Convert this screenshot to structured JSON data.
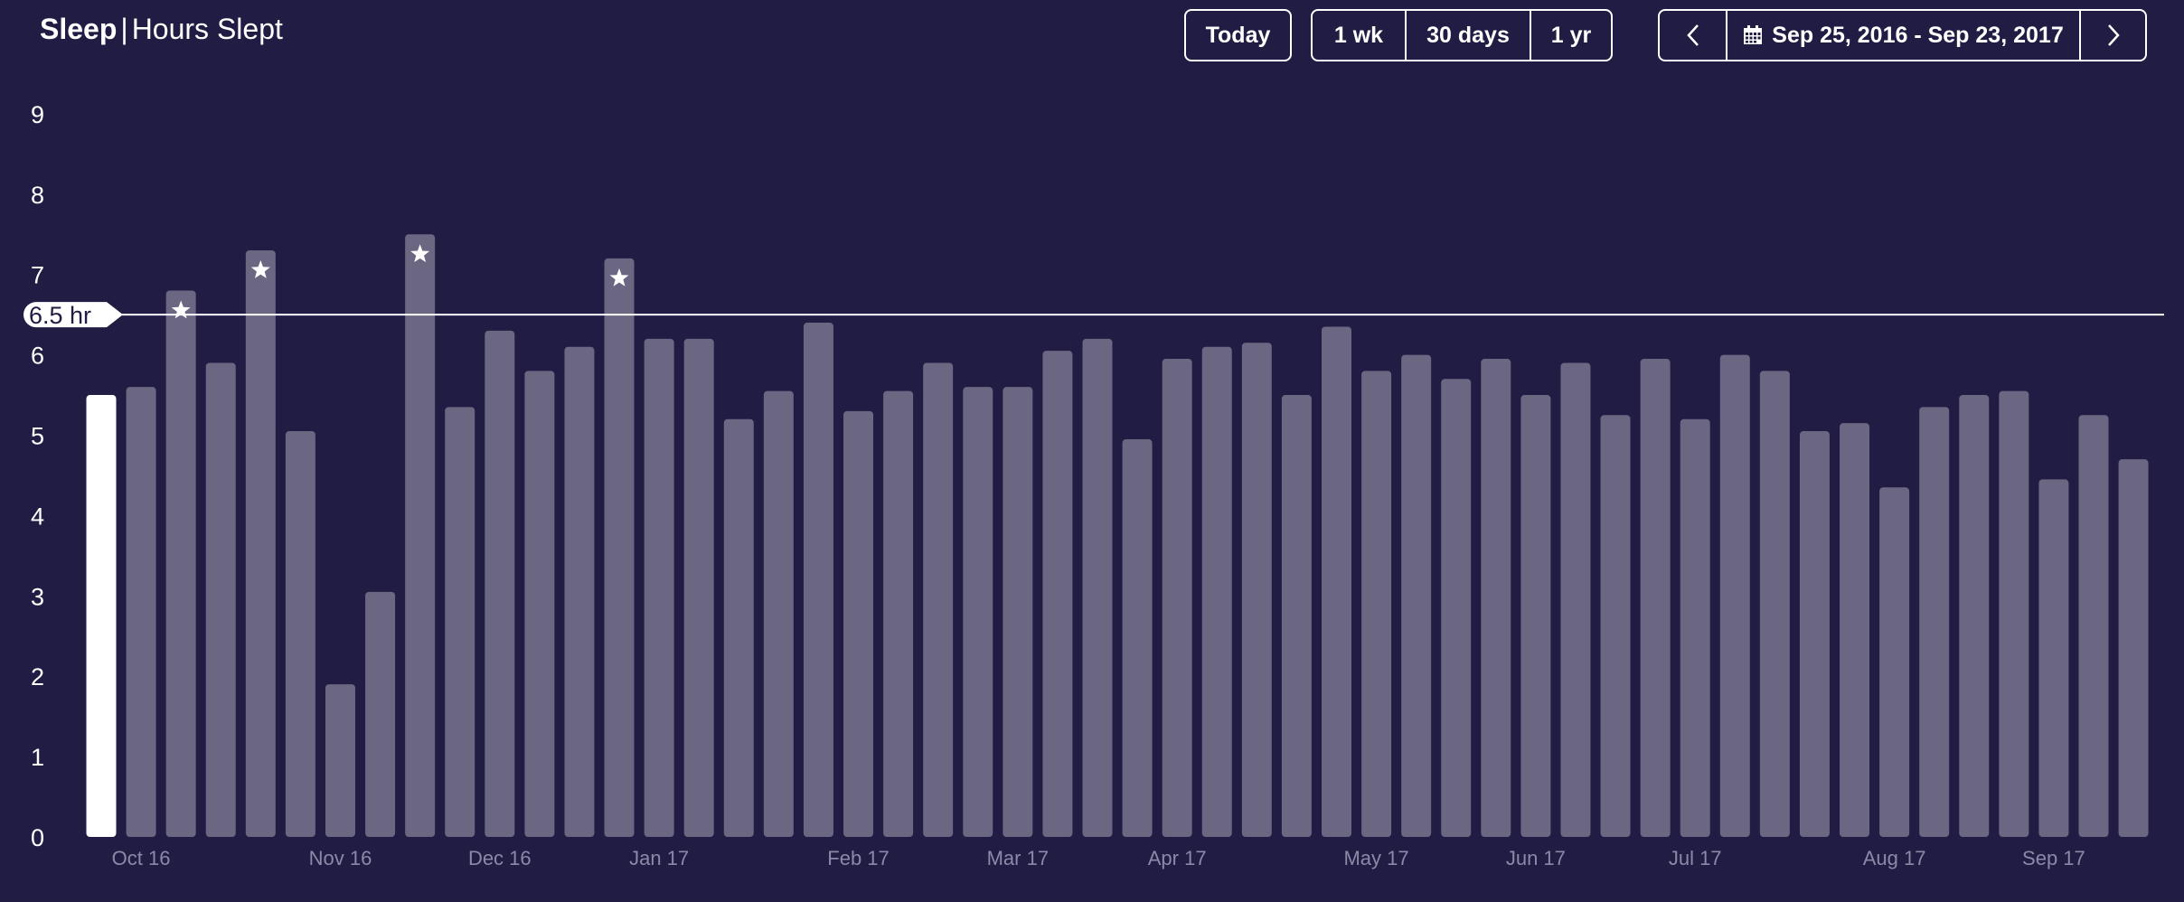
{
  "header": {
    "title": "Sleep",
    "separator": "|",
    "subtitle": "Hours Slept"
  },
  "controls": {
    "today": "Today",
    "ranges": [
      "1 wk",
      "30 days",
      "1 yr"
    ],
    "date_range": "Sep 25, 2016 - Sep 23, 2017"
  },
  "icons": {
    "prev": "chevron-left-icon",
    "next": "chevron-right-icon",
    "calendar": "calendar-icon",
    "goal_met": "star-icon"
  },
  "colors": {
    "background": "#201c44",
    "bar": "#6b6682",
    "current_bar": "#ffffff",
    "goal_line": "#ffffff",
    "text": "#ffffff",
    "month_label": "#8d88a8"
  },
  "chart_data": {
    "type": "bar",
    "title": "Hours Slept",
    "ylim": [
      0,
      9
    ],
    "yticks": [
      0,
      1,
      2,
      3,
      4,
      5,
      6,
      7,
      8,
      9
    ],
    "goal": {
      "value": 6.5,
      "label": "6.5 hr"
    },
    "values": [
      5.5,
      5.6,
      6.8,
      5.9,
      7.3,
      5.05,
      1.9,
      3.05,
      7.5,
      5.35,
      6.3,
      5.8,
      6.1,
      7.2,
      6.2,
      6.2,
      5.2,
      5.55,
      6.4,
      5.3,
      5.55,
      5.9,
      5.6,
      5.6,
      6.05,
      6.2,
      4.95,
      5.95,
      6.1,
      6.15,
      5.5,
      6.35,
      5.8,
      6.0,
      5.7,
      5.95,
      5.5,
      5.9,
      5.25,
      5.95,
      5.2,
      6.0,
      5.8,
      5.05,
      5.15,
      4.35,
      5.35,
      5.5,
      5.55,
      4.45,
      5.25,
      4.7
    ],
    "current_index": 0,
    "goal_met_indices": [
      2,
      4,
      8,
      13
    ],
    "month_labels": [
      {
        "label": "Oct 16",
        "index": 1
      },
      {
        "label": "Nov 16",
        "index": 6
      },
      {
        "label": "Dec 16",
        "index": 10
      },
      {
        "label": "Jan 17",
        "index": 14
      },
      {
        "label": "Feb 17",
        "index": 19
      },
      {
        "label": "Mar 17",
        "index": 23
      },
      {
        "label": "Apr 17",
        "index": 27
      },
      {
        "label": "May 17",
        "index": 32
      },
      {
        "label": "Jun 17",
        "index": 36
      },
      {
        "label": "Jul 17",
        "index": 40
      },
      {
        "label": "Aug 17",
        "index": 45
      },
      {
        "label": "Sep 17",
        "index": 49
      }
    ]
  }
}
